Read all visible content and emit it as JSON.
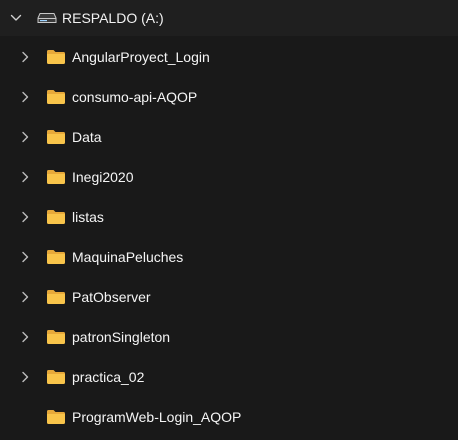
{
  "drive": {
    "label": "RESPALDO (A:)",
    "expanded": true,
    "chevron_icon": "chevron-down-icon",
    "icon": "drive-icon"
  },
  "colors": {
    "background": "#191919",
    "folder": "#f8c44a",
    "folder_dark": "#e6a93a",
    "chevron": "#bdbdbd",
    "text": "#f5f5f5"
  },
  "folders": [
    {
      "name": "AngularProyect_Login",
      "has_children": true
    },
    {
      "name": "consumo-api-AQOP",
      "has_children": true
    },
    {
      "name": "Data",
      "has_children": true
    },
    {
      "name": "Inegi2020",
      "has_children": true
    },
    {
      "name": "listas",
      "has_children": true
    },
    {
      "name": "MaquinaPeluches",
      "has_children": true
    },
    {
      "name": "PatObserver",
      "has_children": true
    },
    {
      "name": "patronSingleton",
      "has_children": true
    },
    {
      "name": "practica_02",
      "has_children": true
    },
    {
      "name": "ProgramWeb-Login_AQOP",
      "has_children": false
    }
  ]
}
